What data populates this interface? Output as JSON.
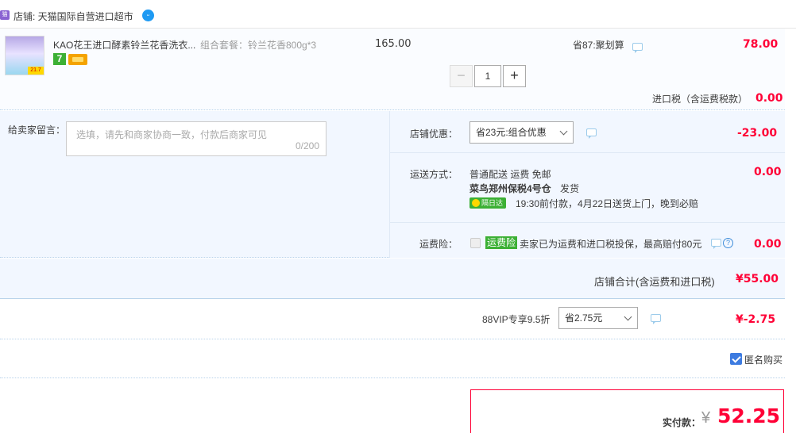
{
  "shop": {
    "icon_label": "猫",
    "label": "店铺: 天猫国际自营进口超市",
    "chat_icon": "chat-bubble-icon"
  },
  "item": {
    "thumb_tag": "21.7",
    "title": "KAO花王进口酵素铃兰花香洗衣...",
    "sku": "组合套餐：铃兰花香800g*3",
    "badge": "7",
    "unit_price": "165.00",
    "qty_minus": "−",
    "qty": "1",
    "qty_plus": "+",
    "promo": "省87:聚划算",
    "total": "78.00"
  },
  "tax": {
    "label": "进口税（含运费税款）",
    "value": "0.00"
  },
  "message": {
    "label": "给卖家留言：",
    "placeholder": "选填，请先和商家协商一致，付款后商家可见",
    "count": "0/200"
  },
  "shop_discount": {
    "label": "店铺优惠：",
    "selected": "省23元:组合优惠",
    "value": "-23.00"
  },
  "shipping": {
    "label": "运送方式：",
    "line1": "普通配送 运费 免邮",
    "warehouse": "菜鸟郑州保税4号仓",
    "dispatch": "发货",
    "fast_badge": "隔日达",
    "eta": "19:30前付款，4月22日送货上门，晚到必赔",
    "value": "0.00"
  },
  "insurance": {
    "label": "运费险：",
    "tag": "运费险",
    "desc": "卖家已为运费和进口税投保，最高赔付80元",
    "help": "?",
    "value": "0.00"
  },
  "shop_total": {
    "label": "店铺合计(含运费和进口税)",
    "value": "¥55.00"
  },
  "vip": {
    "label": "88VIP专享9.5折",
    "selected": "省2.75元",
    "value": "¥-2.75"
  },
  "anonymous": {
    "label": "匿名购买",
    "checked": true
  },
  "payment": {
    "label": "实付款：",
    "currency": "¥",
    "value": "52.25"
  },
  "colors": {
    "price_red": "#ff0036",
    "panel_bg": "#f2f7ff",
    "green": "#3cb035",
    "blue": "#3d7be0"
  }
}
